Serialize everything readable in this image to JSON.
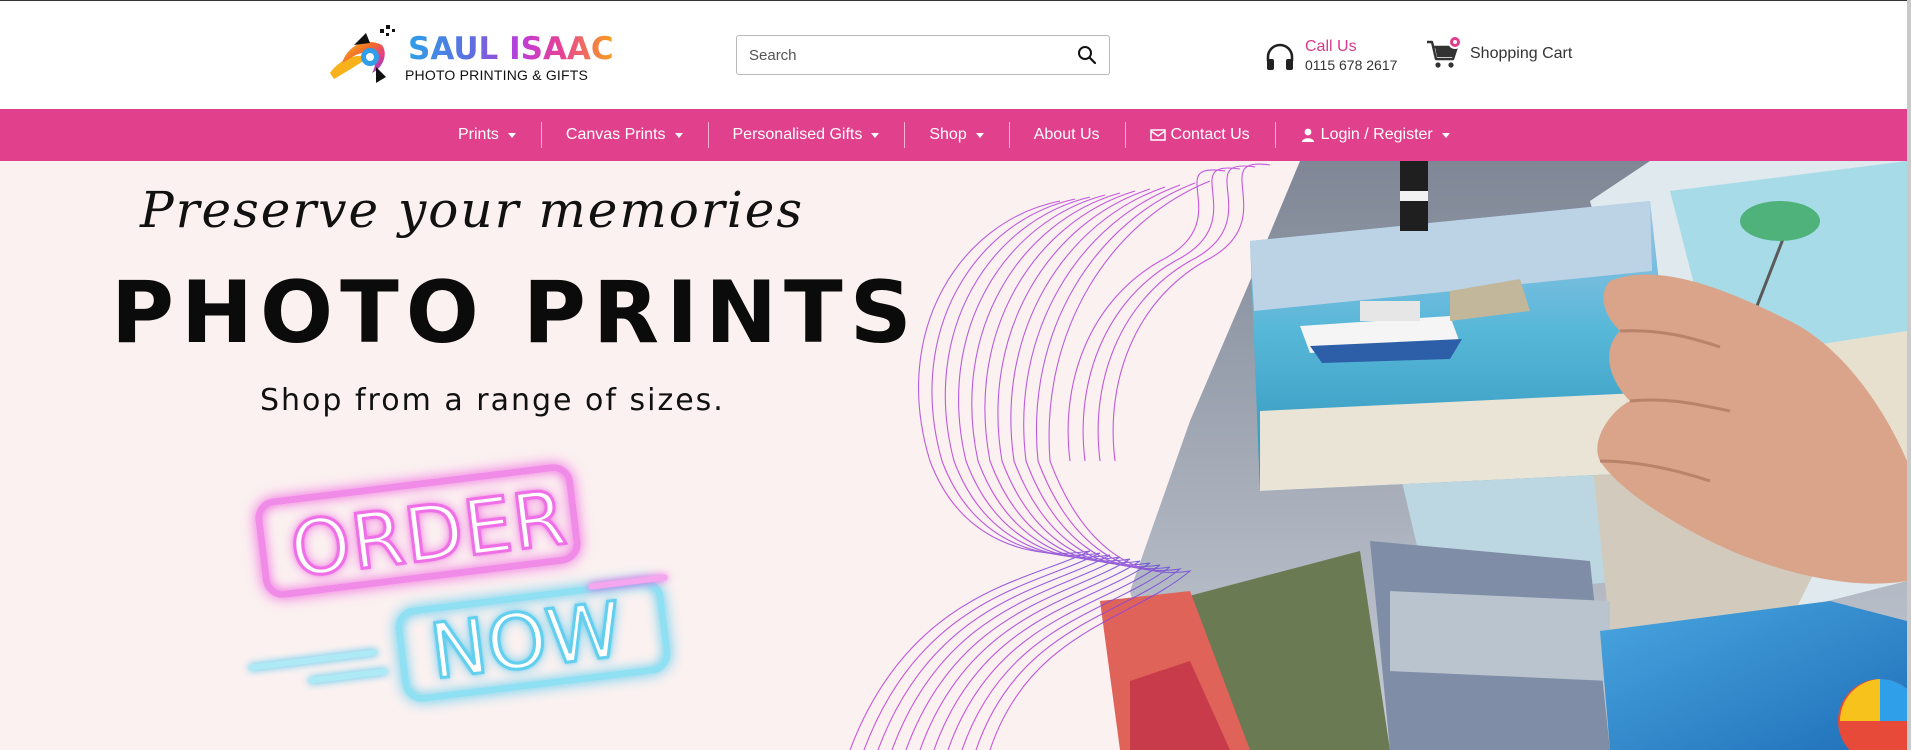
{
  "brand": {
    "name": "SAUL ISAAC",
    "tagline": "PHOTO PRINTING & GIFTS"
  },
  "search": {
    "placeholder": "Search",
    "icon": "search-icon"
  },
  "contact": {
    "label": "Call Us",
    "phone": "0115 678 2617",
    "icon": "headset-icon"
  },
  "cart": {
    "label": "Shopping Cart",
    "icon": "cart-icon"
  },
  "nav": {
    "items": [
      {
        "label": "Prints",
        "dropdown": true
      },
      {
        "label": "Canvas Prints",
        "dropdown": true
      },
      {
        "label": "Personalised Gifts",
        "dropdown": true
      },
      {
        "label": "Shop",
        "dropdown": true
      },
      {
        "label": "About Us",
        "dropdown": false
      },
      {
        "label": "Contact Us",
        "dropdown": false,
        "icon": "envelope-icon"
      },
      {
        "label": "Login / Register",
        "dropdown": true,
        "icon": "user-icon"
      }
    ]
  },
  "hero": {
    "script_text": "Preserve your memories",
    "title": "PHOTO PRINTS",
    "subtitle": "Shop from a range of sizes.",
    "cta_line1": "ORDER",
    "cta_line2": "NOW"
  },
  "colors": {
    "nav_bg": "#e0408c",
    "accent": "#d93a8c",
    "hero_bg": "#fbf1f0",
    "neon_pink": "#f064e0",
    "neon_blue": "#3ec3ef"
  }
}
